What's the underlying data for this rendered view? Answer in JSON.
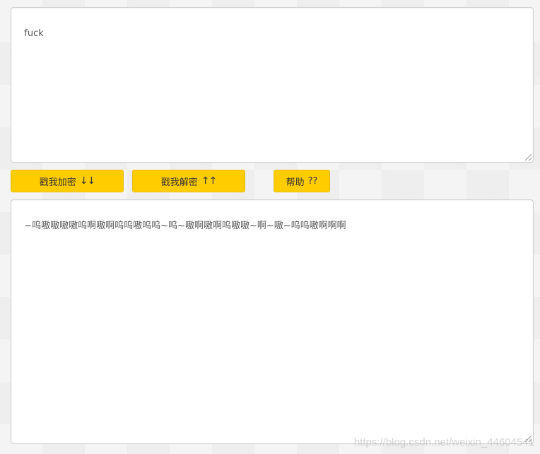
{
  "input": {
    "value": "fuck"
  },
  "buttons": {
    "encrypt_label": "戳我加密",
    "encrypt_icon": "↓↓",
    "decrypt_label": "戳我解密",
    "decrypt_icon": "↑↑",
    "help_label": "帮助",
    "help_icon": "??"
  },
  "output": {
    "value": "~呜嗷嗷嗷嗷呜啊嗷啊呜呜嗷呜呜~呜~嗷啊嗷啊呜嗷嗷~啊~嗷~呜呜嗷啊啊啊"
  },
  "watermark": "https://blog.csdn.net/weixin_44604541",
  "colors": {
    "button_bg": "#ffcc00",
    "page_bg": "#f4f4f4",
    "text": "#555555"
  }
}
